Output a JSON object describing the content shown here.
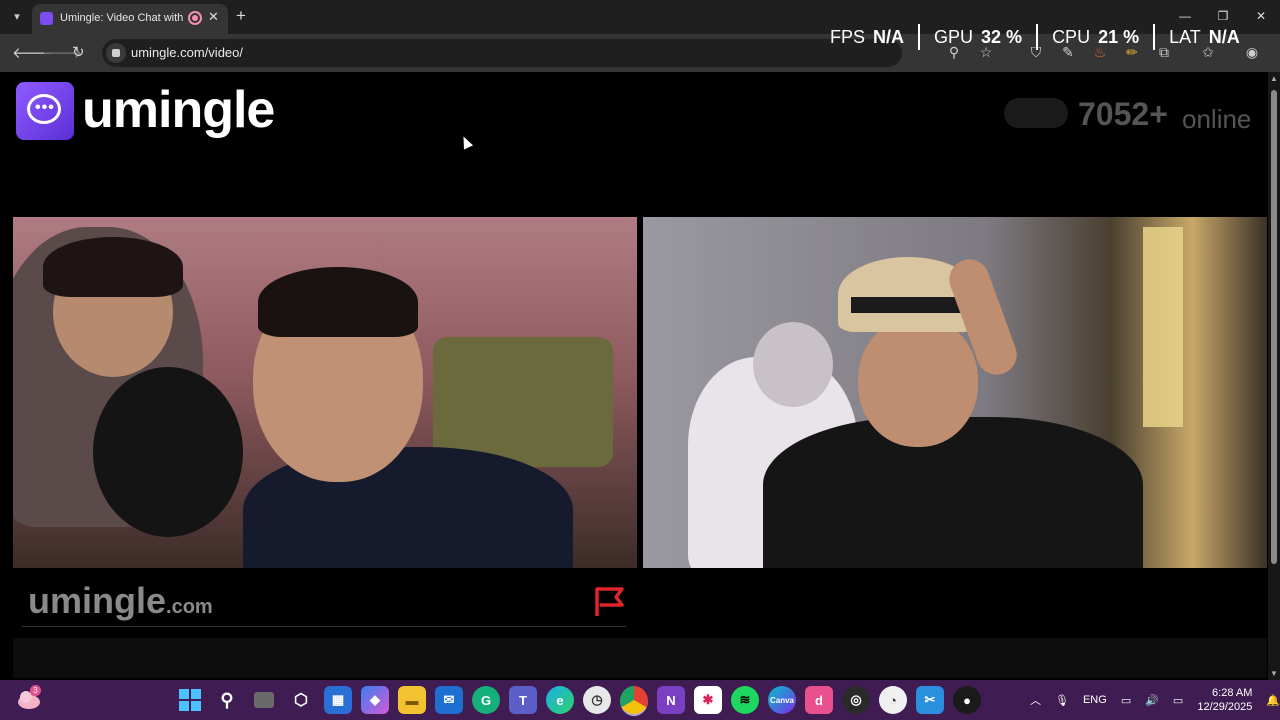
{
  "browser": {
    "tab_title": "Umingle: Video Chat with Strangers",
    "url": "umingle.com/video/",
    "new_tab_symbol": "+",
    "tab_close_symbol": "✕"
  },
  "perf_overlay": {
    "fps_label": "FPS",
    "fps_value": "N/A",
    "gpu_label": "GPU",
    "gpu_value": "32 %",
    "cpu_label": "CPU",
    "cpu_value": "21 %",
    "lat_label": "LAT",
    "lat_value": "N/A"
  },
  "page": {
    "logo_text": "umingle",
    "online_count": "7052+",
    "online_label": "online",
    "watermark_main": "umingle",
    "watermark_suffix": ".com",
    "chat_placeholder": ""
  },
  "taskbar": {
    "notification_count": "3",
    "language": "ENG",
    "time": "6:28 AM",
    "date": "12/29/2025"
  },
  "colors": {
    "brand": "#7b4cf0",
    "report_flag": "#e0262c",
    "taskbar": "#3f1c52"
  }
}
